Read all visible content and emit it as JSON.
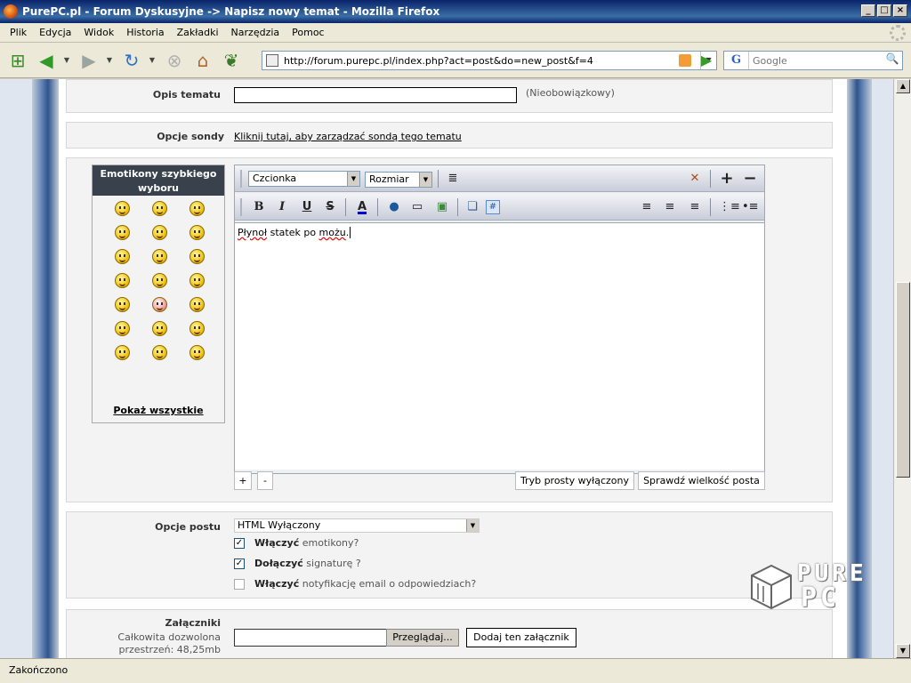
{
  "window": {
    "title": "PurePC.pl - Forum Dyskusyjne -> Napisz nowy temat - Mozilla Firefox"
  },
  "menu": [
    "Plik",
    "Edycja",
    "Widok",
    "Historia",
    "Zakładki",
    "Narzędzia",
    "Pomoc"
  ],
  "nav": {
    "url": "http://forum.purepc.pl/index.php?act=post&do=new_post&f=4",
    "search_engine": "G",
    "search_placeholder": "Google"
  },
  "form": {
    "topic_desc_label": "Opis tematu",
    "topic_desc_optional": "(Nieobowiązkowy)",
    "poll_label": "Opcje sondy",
    "poll_link": "Kliknij tutaj, aby zarządzać sondą tego tematu",
    "emoticons_title": "Emotikony szybkiego wyboru",
    "show_all": "Pokaż wszystkie",
    "font_select": "Czcionka",
    "size_select": "Rozmiar",
    "text_before": "",
    "text_word1": "Płynoł",
    "text_middle": " statek po ",
    "text_word2": "możu",
    "text_after": ".",
    "plus_btn": "+",
    "minus_btn": "-",
    "simple_mode_btn": "Tryb prosty wyłączony",
    "check_length_btn": "Sprawdź wielkość posta",
    "post_options_label": "Opcje postu",
    "html_select": "HTML Wyłączony",
    "cb1_bold": "Włączyć",
    "cb1_rest": " emotikony?",
    "cb2_bold": "Dołączyć",
    "cb2_rest": " signaturę ?",
    "cb3_bold": "Włączyć",
    "cb3_rest": " notyfikację email o odpowiedziach?",
    "attachments_label": "Załączniki",
    "attachments_quota1": "Całkowita dozwolona",
    "attachments_quota2": "przestrzeń: 48,25mb",
    "browse_btn": "Przeglądaj...",
    "add_attachment_btn": "Dodaj ten załącznik"
  },
  "status": "Zakończono",
  "logo": {
    "line1": "PURE",
    "line2": "PC"
  }
}
